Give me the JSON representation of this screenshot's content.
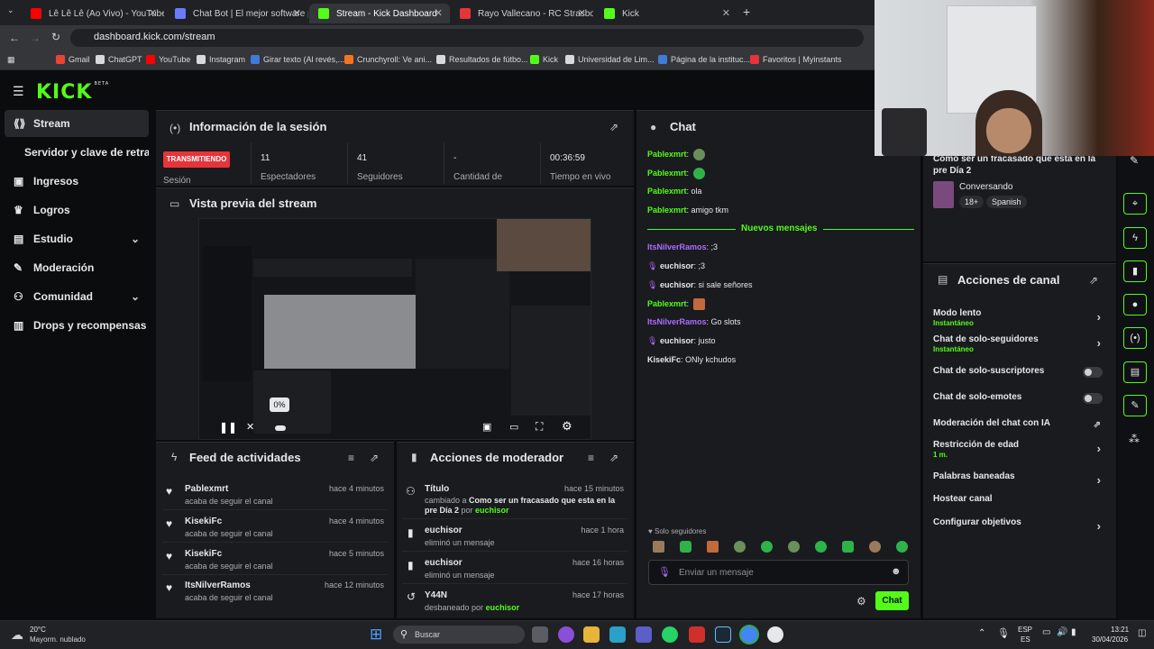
{
  "browser": {
    "tabs": [
      {
        "label": "Lê Lê Lê (Ao Vivo) - YouTube",
        "active": false
      },
      {
        "label": "Chat Bot | El mejor software par...",
        "active": false
      },
      {
        "label": "Stream - Kick Dashboard",
        "active": true
      },
      {
        "label": "Rayo Vallecano - RC Strasbourg",
        "active": false
      },
      {
        "label": "Kick",
        "active": false
      }
    ],
    "new_tab": "+",
    "url": "dashboard.kick.com/stream",
    "bookmarks": [
      "Gmail",
      "ChatGPT",
      "YouTube",
      "Instagram",
      "Girar texto (Al revés,...",
      "Crunchyroll: Ve ani...",
      "Resultados de fútbo...",
      "Kick",
      "Universidad de Lim...",
      "Página de la instituc...",
      "Favoritos | Myinstants"
    ]
  },
  "header": {
    "logo": "KICK",
    "logo_tag": "BETA"
  },
  "sidebar": {
    "items": [
      {
        "label": "Stream"
      },
      {
        "label": "Servidor y clave de retransn"
      },
      {
        "label": "Ingresos"
      },
      {
        "label": "Logros"
      },
      {
        "label": "Estudio"
      },
      {
        "label": "Moderación"
      },
      {
        "label": "Comunidad"
      },
      {
        "label": "Drops y recompensas"
      }
    ]
  },
  "session": {
    "title": "Información de la sesión",
    "badge": "TRANSMITIENDO",
    "session_label": "Sesión",
    "stats": [
      {
        "value": "11",
        "label": "Espectadores"
      },
      {
        "value": "41",
        "label": "Seguidores"
      },
      {
        "value": "-",
        "label": "Cantidad de"
      },
      {
        "value": "00:36:59",
        "label": "Tiempo en vivo"
      }
    ]
  },
  "preview": {
    "title": "Vista previa del stream",
    "volume": "0%"
  },
  "feed": {
    "title": "Feed de actividades",
    "items": [
      {
        "name": "Pablexmrt",
        "time": "hace 4 minutos",
        "desc": "acaba de seguir el canal"
      },
      {
        "name": "KisekiFc",
        "time": "hace 4 minutos",
        "desc": "acaba de seguir el canal"
      },
      {
        "name": "KisekiFc",
        "time": "hace 5 minutos",
        "desc": "acaba de seguir el canal"
      },
      {
        "name": "ItsNilverRamos",
        "time": "hace 12 minutos",
        "desc": "acaba de seguir el canal"
      }
    ]
  },
  "moderator": {
    "title": "Acciones de moderador",
    "items": [
      {
        "name": "Título",
        "time": "hace 15 minutos",
        "desc1": "cambiado a ",
        "bold": "Como ser un fracasado que esta en la pre Día 2",
        "desc2": " por ",
        "by": "euchisor"
      },
      {
        "name": "euchisor",
        "time": "hace 1 hora",
        "desc1": "eliminó un mensaje"
      },
      {
        "name": "euchisor",
        "time": "hace 16 horas",
        "desc1": "eliminó un mensaje"
      },
      {
        "name": "Y44N",
        "time": "hace 17 horas",
        "desc1": "desbaneado por ",
        "by": "euchisor"
      }
    ]
  },
  "chat": {
    "title": "Chat",
    "messages": [
      {
        "user": "Pablexmrt",
        "color": "g",
        "text": ""
      },
      {
        "user": "Pablexmrt",
        "color": "g",
        "text": ""
      },
      {
        "user": "Pablexmrt",
        "color": "g",
        "text": "ola"
      },
      {
        "user": "Pablexmrt",
        "color": "g",
        "text": "amigo tkm"
      },
      {
        "user": "ItsNilverRamos",
        "color": "p",
        "text": ";3"
      },
      {
        "user": "euchisor",
        "color": "w",
        "text": ";3"
      },
      {
        "user": "euchisor",
        "color": "w",
        "text": "si sale señores"
      },
      {
        "user": "Pablexmrt",
        "color": "g",
        "text": ""
      },
      {
        "user": "ItsNilverRamos",
        "color": "p",
        "text": "Go slots"
      },
      {
        "user": "euchisor",
        "color": "w",
        "text": "justo"
      },
      {
        "user": "KisekiFc",
        "color": "w",
        "text": "ONly kchudos"
      }
    ],
    "new_messages": "Nuevos mensajes",
    "followers_only": "Solo seguidores",
    "input_placeholder": "Enviar un mensaje",
    "send": "Chat"
  },
  "stream_info": {
    "title": "Como ser un fracasado que esta en la pre Día 2",
    "category": "Conversando",
    "tags": [
      "18+",
      "Spanish"
    ]
  },
  "channel_actions": {
    "title": "Acciones de canal",
    "items": [
      {
        "label": "Modo lento",
        "sub": "Instantáneo",
        "ctrl": "chevron"
      },
      {
        "label": "Chat de solo-seguidores",
        "sub": "Instantáneo",
        "ctrl": "chevron"
      },
      {
        "label": "Chat de solo-suscriptores",
        "sub": "",
        "ctrl": "toggle"
      },
      {
        "label": "Chat de solo-emotes",
        "sub": "",
        "ctrl": "toggle"
      },
      {
        "label": "Moderación del chat con IA",
        "sub": "",
        "ctrl": "ext"
      },
      {
        "label": "Restricción de edad",
        "sub": "1 m.",
        "ctrl": "chevron"
      },
      {
        "label": "Palabras baneadas",
        "sub": "",
        "ctrl": "chevron"
      },
      {
        "label": "Hostear canal",
        "sub": "",
        "ctrl": "none"
      },
      {
        "label": "Configurar objetivos",
        "sub": "",
        "ctrl": "chevron"
      }
    ]
  },
  "taskbar": {
    "weather_temp": "20°C",
    "weather_desc": "Mayorm. nublado",
    "search": "Buscar",
    "lang1": "ESP",
    "lang2": "ES",
    "time": "13:21",
    "date": "30/04/2026"
  },
  "colors": {
    "accent": "#53fc18",
    "live": "#e5343a",
    "purple": "#b06bff"
  }
}
